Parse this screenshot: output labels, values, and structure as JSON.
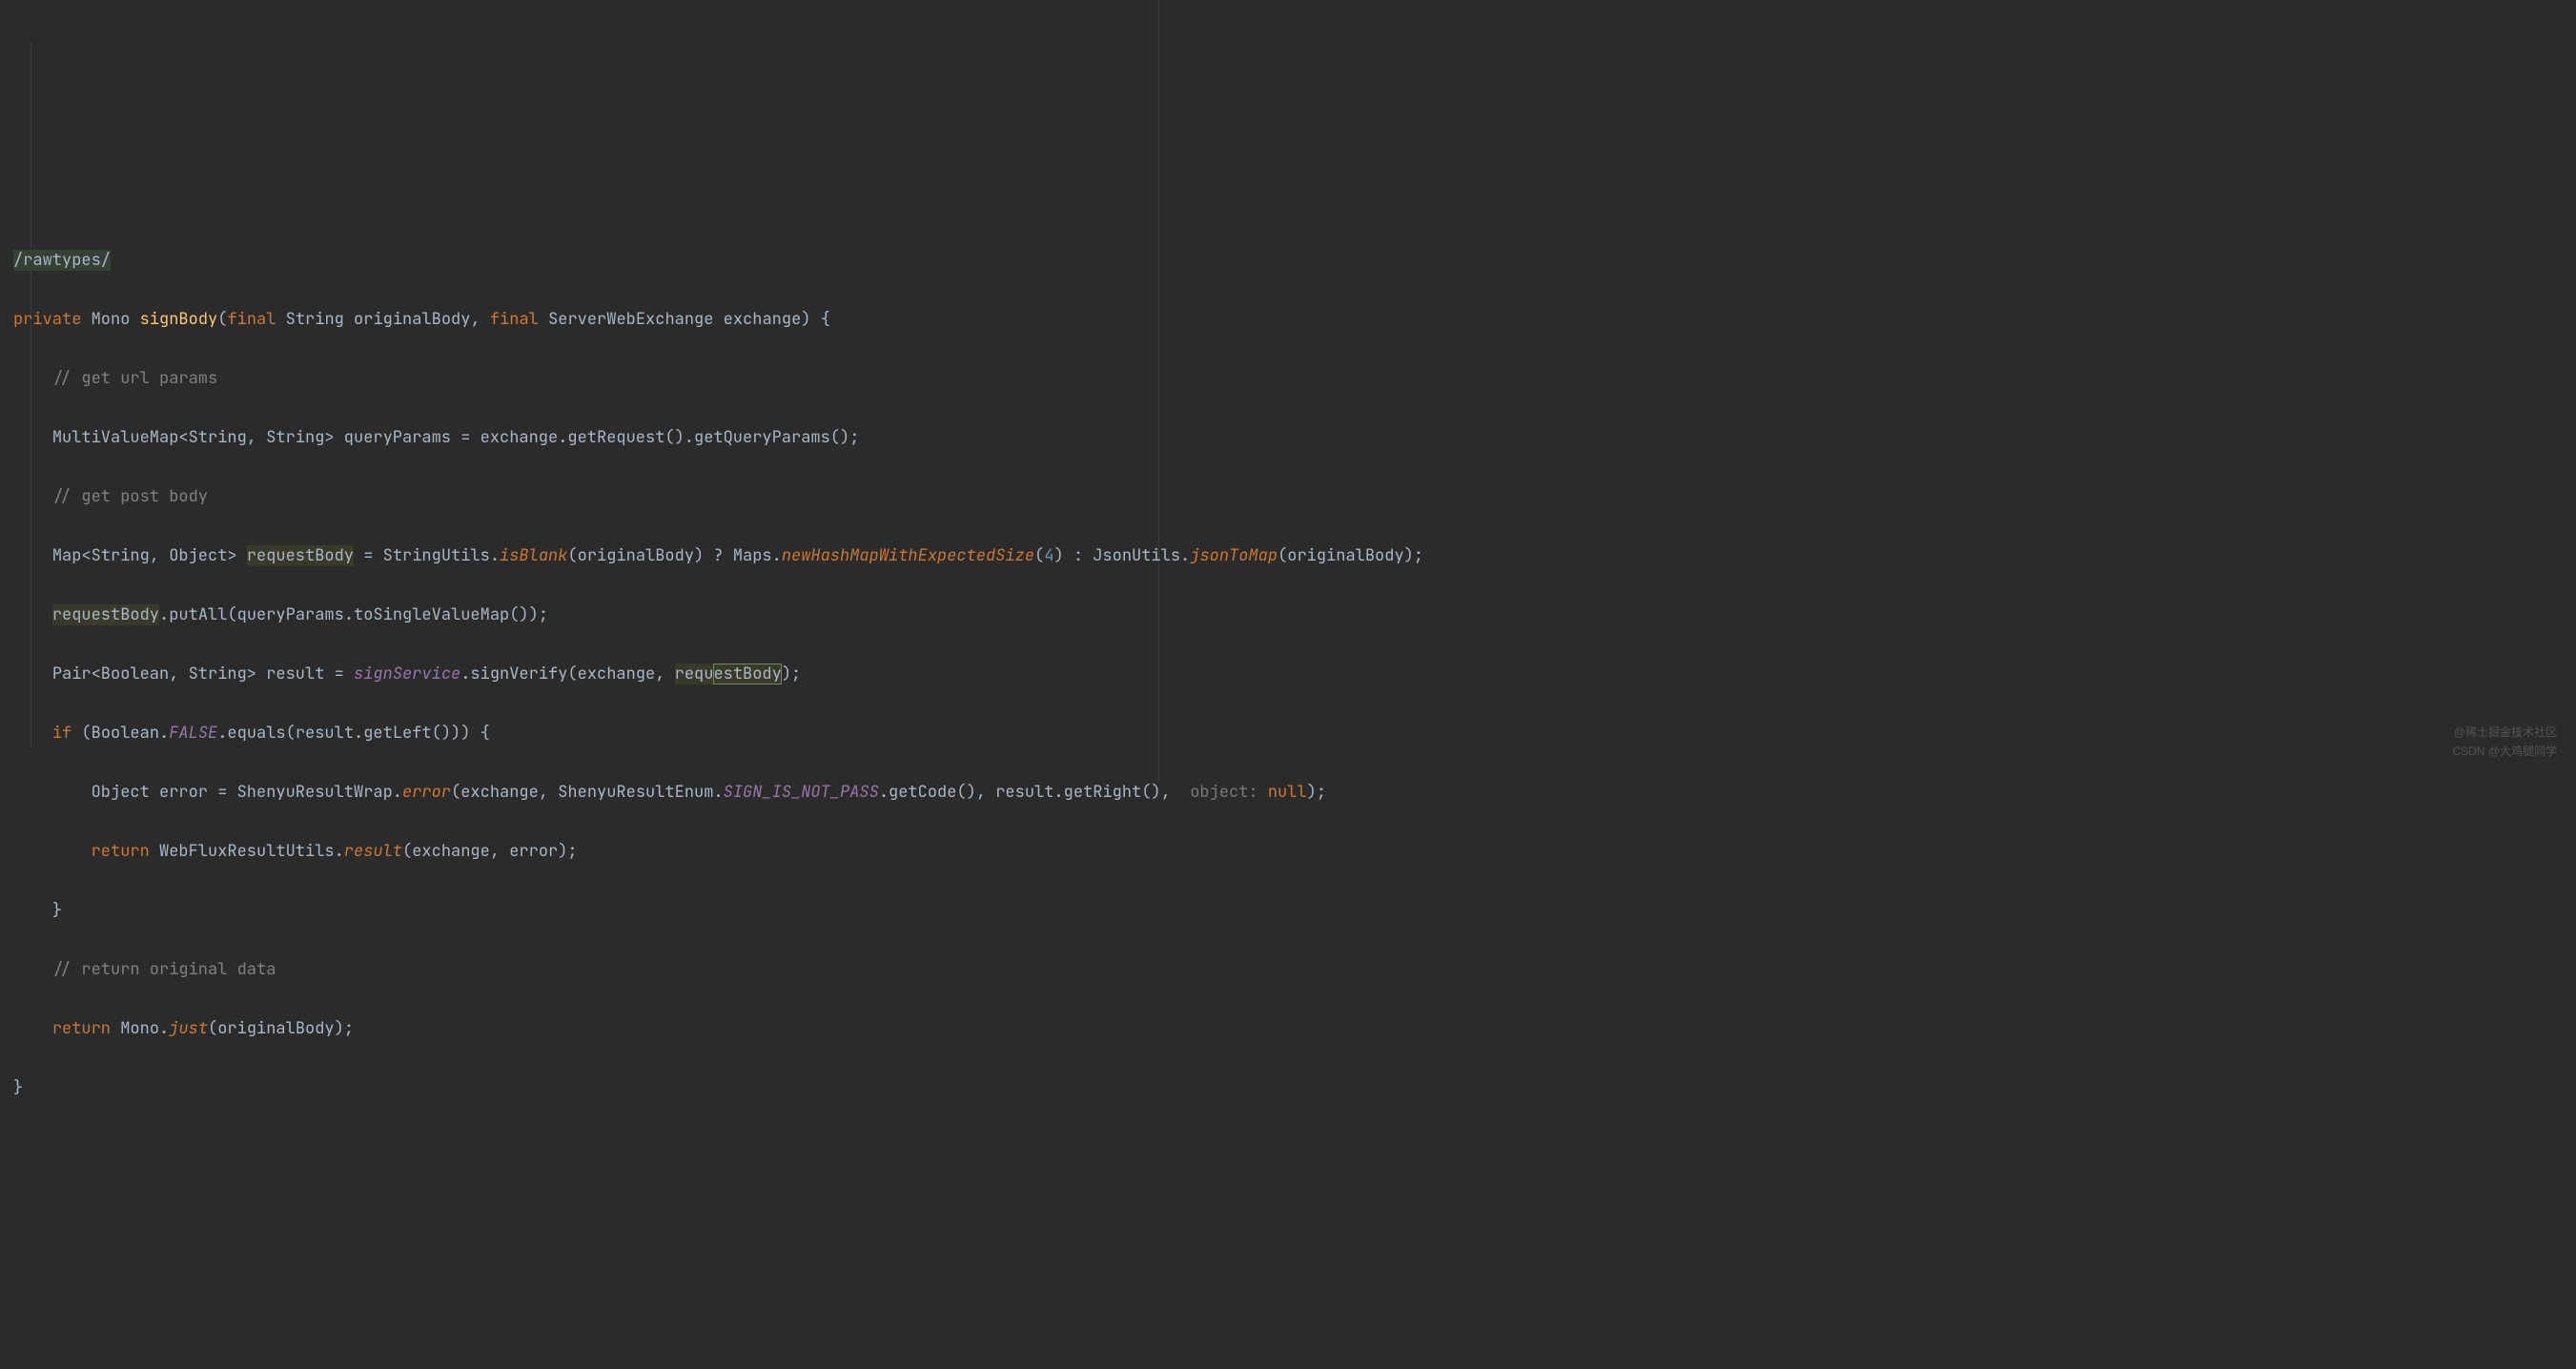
{
  "code": {
    "l1": {
      "doc": "/rawtypes/"
    },
    "l2": {
      "kw_private": "private",
      "type_mono": "Mono",
      "method": "signBody",
      "p1_final": "final",
      "p1_type": "String",
      "p1_name": "originalBody",
      "p2_final": "final",
      "p2_type": "ServerWebExchange",
      "p2_name": "exchange",
      "open": " {"
    },
    "l3": {
      "comment": "// get url params"
    },
    "l4": {
      "before": "MultiValueMap<String, String> queryParams = exchange.getRequest().getQueryParams();"
    },
    "l5": {
      "comment": "// get post body"
    },
    "l6": {
      "type": "Map<String, Object> ",
      "var": "requestBody",
      "mid1": " = StringUtils.",
      "isBlank": "isBlank",
      "mid2": "(originalBody) ? Maps.",
      "newMap": "newHashMapWithExpectedSize",
      "open": "(",
      "num": "4",
      "mid3": ") : JsonUtils.",
      "jsonToMap": "jsonToMap",
      "end": "(originalBody);"
    },
    "l7": {
      "var": "requestBody",
      "rest": ".putAll(queryParams.toSingleValueMap());"
    },
    "l8": {
      "before": "Pair<Boolean, String> result = ",
      "svc": "signService",
      "mid": ".signVerify(exchange, ",
      "req_a": "requ",
      "req_b": "estBody",
      "end": ");"
    },
    "l9": {
      "kw_if": "if",
      "before": " (Boolean.",
      "FALSE": "FALSE",
      "after": ".equals(result.getLeft())) {"
    },
    "l10": {
      "before": "Object error = ShenyuResultWrap.",
      "error": "error",
      "mid1": "(exchange, ShenyuResultEnum.",
      "SIGN": "SIGN_IS_NOT_PASS",
      "mid2": ".getCode(), result.getRight(), ",
      "hint": " object: ",
      "null": "null",
      "end": ");"
    },
    "l11": {
      "kw_return": "return",
      "before": " WebFluxResultUtils.",
      "result": "result",
      "after": "(exchange, error);"
    },
    "l12": {
      "brace": "}"
    },
    "l13": {
      "comment": "// return original data"
    },
    "l14": {
      "kw_return": "return",
      "before": " Mono.",
      "just": "just",
      "after": "(originalBody);"
    },
    "l15": {
      "brace": "}"
    }
  },
  "watermarks": {
    "w1": "@稀土掘金技术社区",
    "w2": "CSDN @大鸡腿同学"
  }
}
